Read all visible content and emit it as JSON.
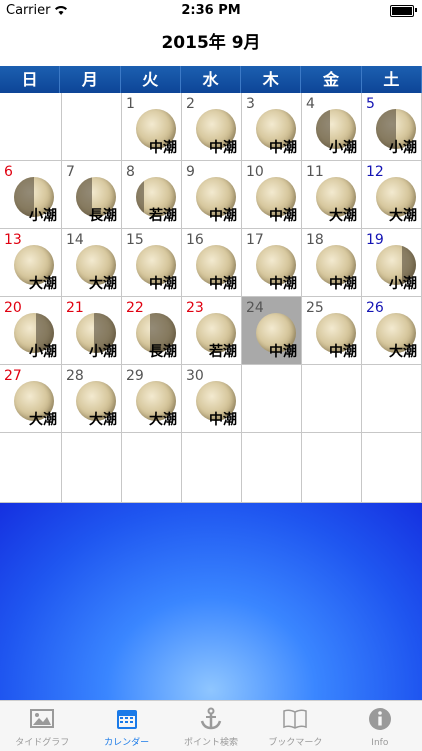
{
  "status_bar": {
    "carrier": "Carrier",
    "time": "2:36 PM"
  },
  "header": {
    "title": "2015年 9月"
  },
  "weekdays": [
    "日",
    "月",
    "火",
    "水",
    "木",
    "金",
    "土"
  ],
  "weeks": [
    [
      null,
      null,
      {
        "day": "1",
        "tide": "中潮"
      },
      {
        "day": "2",
        "tide": "中潮"
      },
      {
        "day": "3",
        "tide": "中潮"
      },
      {
        "day": "4",
        "tide": "小潮"
      },
      {
        "day": "5",
        "tide": "小潮"
      }
    ],
    [
      {
        "day": "6",
        "tide": "小潮"
      },
      {
        "day": "7",
        "tide": "長潮"
      },
      {
        "day": "8",
        "tide": "若潮"
      },
      {
        "day": "9",
        "tide": "中潮"
      },
      {
        "day": "10",
        "tide": "中潮"
      },
      {
        "day": "11",
        "tide": "大潮"
      },
      {
        "day": "12",
        "tide": "大潮"
      }
    ],
    [
      {
        "day": "13",
        "tide": "大潮"
      },
      {
        "day": "14",
        "tide": "大潮"
      },
      {
        "day": "15",
        "tide": "中潮"
      },
      {
        "day": "16",
        "tide": "中潮"
      },
      {
        "day": "17",
        "tide": "中潮"
      },
      {
        "day": "18",
        "tide": "中潮"
      },
      {
        "day": "19",
        "tide": "小潮"
      }
    ],
    [
      {
        "day": "20",
        "tide": "小潮"
      },
      {
        "day": "21",
        "tide": "小潮"
      },
      {
        "day": "22",
        "tide": "長潮"
      },
      {
        "day": "23",
        "tide": "若潮"
      },
      {
        "day": "24",
        "tide": "中潮"
      },
      {
        "day": "25",
        "tide": "中潮"
      },
      {
        "day": "26",
        "tide": "大潮"
      }
    ],
    [
      {
        "day": "27",
        "tide": "大潮"
      },
      {
        "day": "28",
        "tide": "大潮"
      },
      {
        "day": "29",
        "tide": "大潮"
      },
      {
        "day": "30",
        "tide": "中潮"
      },
      null,
      null,
      null
    ],
    [
      null,
      null,
      null,
      null,
      null,
      null,
      null
    ]
  ],
  "holidays": [
    "21",
    "22",
    "23"
  ],
  "today": "24",
  "moon_phase_icon": "moon-phase-icon",
  "colors": {
    "sunday": "#e00010",
    "saturday": "#1414b4",
    "header_bar": "#0d4597",
    "active_tab": "#1a7ae8"
  },
  "tabs": [
    {
      "label": "タイドグラフ",
      "icon": "image-icon",
      "active": false
    },
    {
      "label": "カレンダー",
      "icon": "calendar-icon",
      "active": true
    },
    {
      "label": "ポイント検索",
      "icon": "anchor-icon",
      "active": false
    },
    {
      "label": "ブックマーク",
      "icon": "book-icon",
      "active": false
    },
    {
      "label": "Info",
      "icon": "info-icon",
      "active": false
    }
  ]
}
